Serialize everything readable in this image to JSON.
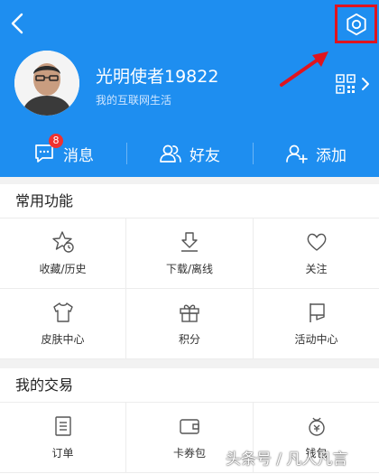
{
  "header": {
    "username": "光明使者19822",
    "subtitle": "我的互联网生活",
    "accent_color": "#1e8ef0",
    "highlight_color": "#e0141e"
  },
  "actions": [
    {
      "label": "消息",
      "icon": "message-icon",
      "badge": "8"
    },
    {
      "label": "好友",
      "icon": "friends-icon"
    },
    {
      "label": "添加",
      "icon": "add-friend-icon"
    }
  ],
  "common": {
    "title": "常用功能",
    "items": [
      {
        "label": "收藏/历史",
        "icon": "star-history-icon"
      },
      {
        "label": "下载/离线",
        "icon": "download-icon"
      },
      {
        "label": "关注",
        "icon": "heart-icon"
      },
      {
        "label": "皮肤中心",
        "icon": "tshirt-icon"
      },
      {
        "label": "积分",
        "icon": "gift-icon"
      },
      {
        "label": "活动中心",
        "icon": "flag-icon"
      }
    ]
  },
  "trade": {
    "title": "我的交易",
    "items": [
      {
        "label": "订单",
        "icon": "order-icon"
      },
      {
        "label": "卡券包",
        "icon": "coupon-wallet-icon"
      },
      {
        "label": "钱包",
        "icon": "wallet-icon"
      }
    ]
  },
  "watermark": "头条号 / 凡人凡言"
}
